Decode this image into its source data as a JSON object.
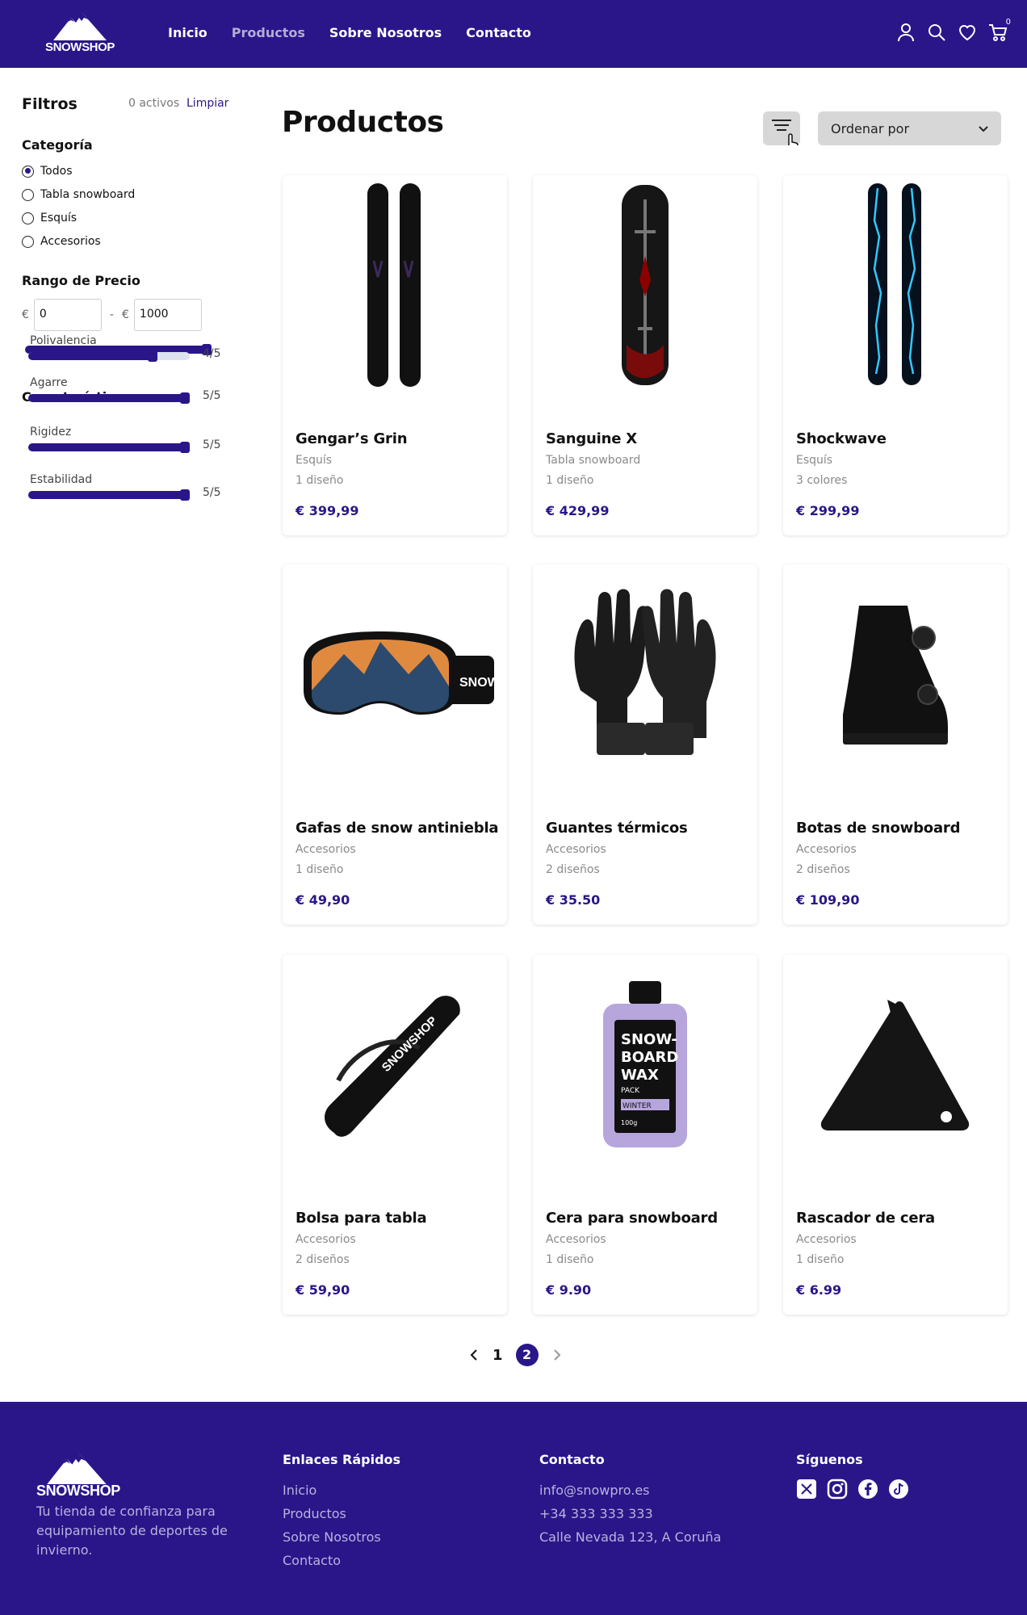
{
  "header": {
    "logo": "SNOWSHOP",
    "nav": [
      "Inicio",
      "Productos",
      "Sobre Nosotros",
      "Contacto"
    ],
    "active_nav": "Productos",
    "cart_count": "0"
  },
  "filters": {
    "title": "Filtros",
    "active_count": "0 activos",
    "clear": "Limpiar",
    "category_title": "Categoría",
    "categories": [
      "Todos",
      "Tabla snowboard",
      "Esquís",
      "Accesorios"
    ],
    "selected_category": "Todos",
    "price_title": "Rango de Precio",
    "currency": "€",
    "separator": "-",
    "price_min": "0",
    "price_max": "1000",
    "features_title": "Características",
    "features": [
      {
        "label": "Polivalencia",
        "value": "4/5",
        "level": 0.8
      },
      {
        "label": "Agarre",
        "value": "5/5",
        "level": 1.0
      },
      {
        "label": "Rigidez",
        "value": "5/5",
        "level": 1.0
      },
      {
        "label": "Estabilidad",
        "value": "5/5",
        "level": 1.0
      }
    ]
  },
  "main": {
    "title": "Productos",
    "sort_label": "Ordenar por",
    "products": [
      {
        "name": "Gengar’s Grin",
        "category": "Esquís",
        "variants": "1 diseño",
        "price": "€ 399,99",
        "icon": "skis-dark"
      },
      {
        "name": "Sanguine X",
        "category": "Tabla snowboard",
        "variants": "1 diseño",
        "price": "€ 429,99",
        "icon": "snowboard-red"
      },
      {
        "name": "Shockwave",
        "category": "Esquís",
        "variants": "3 colores",
        "price": "€ 299,99",
        "icon": "skis-lightning"
      },
      {
        "name": "Gafas de snow antiniebla",
        "category": "Accesorios",
        "variants": "1 diseño",
        "price": "€ 49,90",
        "icon": "goggles"
      },
      {
        "name": "Guantes térmicos",
        "category": "Accesorios",
        "variants": "2 diseños",
        "price": "€ 35.50",
        "icon": "gloves"
      },
      {
        "name": "Botas de snowboard",
        "category": "Accesorios",
        "variants": "2 diseños",
        "price": "€ 109,90",
        "icon": "boot"
      },
      {
        "name": "Bolsa para tabla",
        "category": "Accesorios",
        "variants": "2 diseños",
        "price": "€ 59,90",
        "icon": "board-bag"
      },
      {
        "name": "Cera para snowboard",
        "category": "Accesorios",
        "variants": "1 diseño",
        "price": "€ 9.90",
        "icon": "wax-bottle"
      },
      {
        "name": "Rascador de cera",
        "category": "Accesorios",
        "variants": "1 diseño",
        "price": "€ 6.99",
        "icon": "wax-scraper"
      }
    ],
    "pagination": {
      "pages": [
        "1",
        "2"
      ],
      "current": "2"
    }
  },
  "footer": {
    "logo": "SNOWSHOP",
    "tagline": "Tu tienda de confianza para equipamiento de deportes de invierno.",
    "links_title": "Enlaces Rápidos",
    "links": [
      "Inicio",
      "Productos",
      "Sobre Nosotros",
      "Contacto"
    ],
    "contact_title": "Contacto",
    "email": "info@snowpro.es",
    "phone": "+34 333 333 333",
    "address": "Calle Nevada 123, A Coruña",
    "social_title": "Síguenos",
    "socials": [
      "x-icon",
      "instagram-icon",
      "facebook-icon",
      "tiktok-icon"
    ]
  },
  "colors": {
    "brand": "#2a1689",
    "muted": "#8a8a8a"
  },
  "product_images": {
    "goggles_lens_text": "SNOWSHOP",
    "bag_text": "SNOWSHOP",
    "wax_label": [
      "SNOW-",
      "BOARD",
      "WAX"
    ],
    "wax_pack": "PACK",
    "wax_winter": "WINTER",
    "wax_weight": "100g"
  }
}
